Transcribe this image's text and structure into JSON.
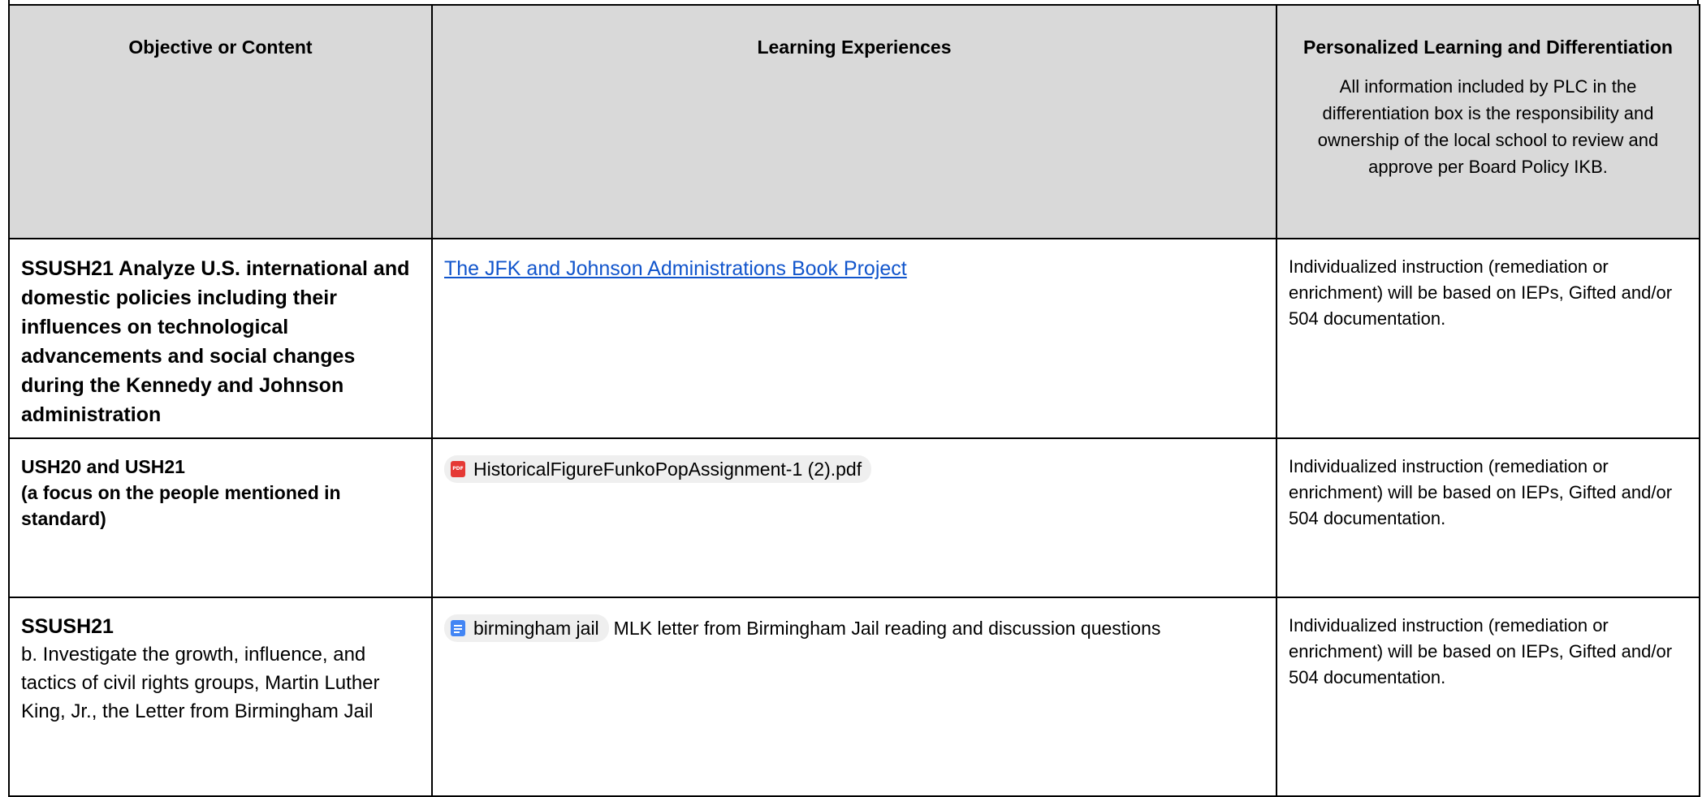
{
  "header": {
    "col1": "Objective or Content",
    "col2": "Learning Experiences",
    "col3_title": "Personalized Learning and Differentiation",
    "col3_note": "All information included by PLC in the differentiation box is the responsibility and ownership of the local school to review and approve per Board Policy IKB."
  },
  "rows": [
    {
      "objective": "SSUSH21 Analyze U.S. international and domestic policies including their influences on technological advancements and social changes during the Kennedy and Johnson administration",
      "link_text": "The JFK and Johnson Administrations Book Project",
      "differentiation": "Individualized instruction (remediation or enrichment) will be based on IEPs, Gifted and/or 504 documentation."
    },
    {
      "objective_line1": "USH20 and USH21",
      "objective_line2": "(a focus on the people mentioned in standard)",
      "chip_label": "HistoricalFigureFunkoPopAssignment-1 (2).pdf",
      "chip_icon": "pdf-file-icon",
      "differentiation": "Individualized instruction (remediation or enrichment) will be based on IEPs, Gifted and/or 504 documentation."
    },
    {
      "objective_title": "SSUSH21",
      "objective_body": "b. Investigate the growth, influence, and tactics of civil rights groups, Martin Luther King, Jr., the Letter from Birmingham Jail",
      "chip_label": "birmingham jail",
      "chip_icon": "google-docs-icon",
      "chip_followup": "MLK letter from Birmingham Jail reading and discussion questions",
      "differentiation": "Individualized instruction (remediation or enrichment) will be based on IEPs, Gifted and/or 504 documentation."
    }
  ],
  "colors": {
    "header_bg": "#d9d9d9",
    "link": "#1155cc",
    "pdf_icon": "#e53935",
    "docs_icon": "#4285f4",
    "chip_bg": "#efefef"
  }
}
